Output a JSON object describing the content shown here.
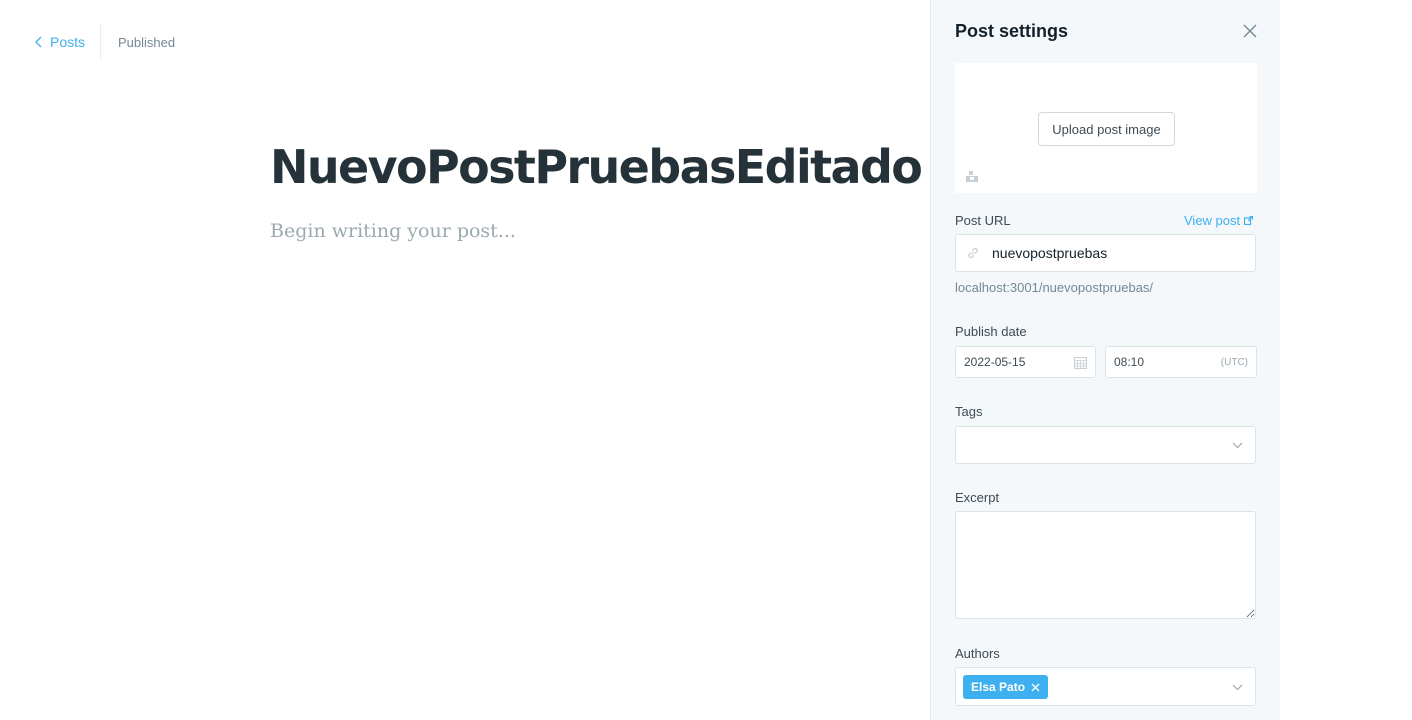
{
  "header": {
    "back_label": "Posts",
    "status": "Published"
  },
  "editor": {
    "title": "NuevoPostPruebasEditado",
    "body_placeholder": "Begin writing your post..."
  },
  "settings": {
    "title": "Post settings",
    "upload_image_label": "Upload post image",
    "post_url": {
      "label": "Post URL",
      "view_link": "View post",
      "value": "nuevopostpruebas",
      "preview": "localhost:3001/nuevopostpruebas/"
    },
    "publish_date": {
      "label": "Publish date",
      "date": "2022-05-15",
      "time": "08:10",
      "timezone": "(UTC)"
    },
    "tags": {
      "label": "Tags"
    },
    "excerpt": {
      "label": "Excerpt",
      "value": ""
    },
    "authors": {
      "label": "Authors",
      "items": [
        {
          "name": "Elsa Pato"
        }
      ]
    }
  },
  "colors": {
    "accent": "#3eb0ef",
    "panel_bg": "#f4f8fb",
    "title_text": "#26323a",
    "muted_text": "#738a94"
  },
  "icons": {
    "back": "chevron-left-icon",
    "close": "close-icon",
    "image": "image-placeholder-icon",
    "external": "external-link-icon",
    "link": "link-icon",
    "calendar": "calendar-icon",
    "dropdown": "chevron-down-icon",
    "remove": "remove-icon"
  }
}
